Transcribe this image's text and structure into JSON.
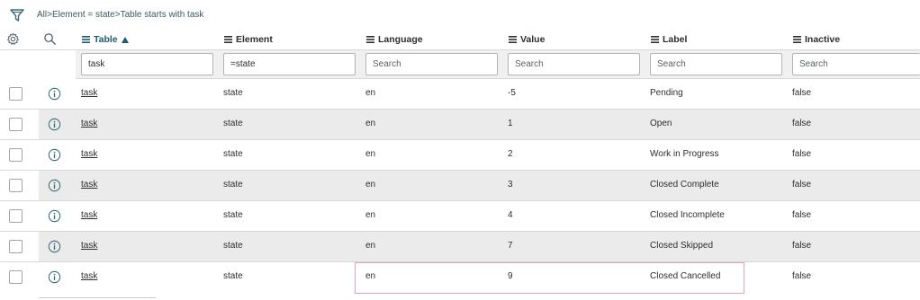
{
  "breadcrumb": {
    "items": [
      "All",
      "Element = state",
      "Table starts with task"
    ],
    "separator": ">"
  },
  "columns": [
    {
      "key": "table",
      "label": "Table",
      "sorted": "asc"
    },
    {
      "key": "element",
      "label": "Element"
    },
    {
      "key": "language",
      "label": "Language"
    },
    {
      "key": "value",
      "label": "Value"
    },
    {
      "key": "label",
      "label": "Label"
    },
    {
      "key": "inactive",
      "label": "Inactive"
    }
  ],
  "filters": {
    "table": {
      "value": "task",
      "placeholder": "Search"
    },
    "element": {
      "value": "=state",
      "placeholder": "Search"
    },
    "language": {
      "value": "",
      "placeholder": "Search"
    },
    "value": {
      "value": "",
      "placeholder": "Search"
    },
    "label": {
      "value": "",
      "placeholder": "Search"
    },
    "inactive": {
      "value": "",
      "placeholder": "Search"
    }
  },
  "rows": [
    {
      "table": "task",
      "element": "state",
      "language": "en",
      "value": "-5",
      "label": "Pending",
      "inactive": "false"
    },
    {
      "table": "task",
      "element": "state",
      "language": "en",
      "value": "1",
      "label": "Open",
      "inactive": "false"
    },
    {
      "table": "task",
      "element": "state",
      "language": "en",
      "value": "2",
      "label": "Work in Progress",
      "inactive": "false"
    },
    {
      "table": "task",
      "element": "state",
      "language": "en",
      "value": "3",
      "label": "Closed Complete",
      "inactive": "false"
    },
    {
      "table": "task",
      "element": "state",
      "language": "en",
      "value": "4",
      "label": "Closed Incomplete",
      "inactive": "false"
    },
    {
      "table": "task",
      "element": "state",
      "language": "en",
      "value": "7",
      "label": "Closed Skipped",
      "inactive": "false"
    },
    {
      "table": "task",
      "element": "state",
      "language": "en",
      "value": "9",
      "label": "Closed Cancelled",
      "inactive": "false"
    }
  ],
  "colors": {
    "accent": "#1f5a70",
    "row_alt": "#ebebeb",
    "highlight": "#e5a1b8"
  },
  "icons": [
    "filter-icon",
    "gear-icon",
    "search-icon",
    "column-menu-icon",
    "sort-ascending-icon",
    "info-icon"
  ]
}
